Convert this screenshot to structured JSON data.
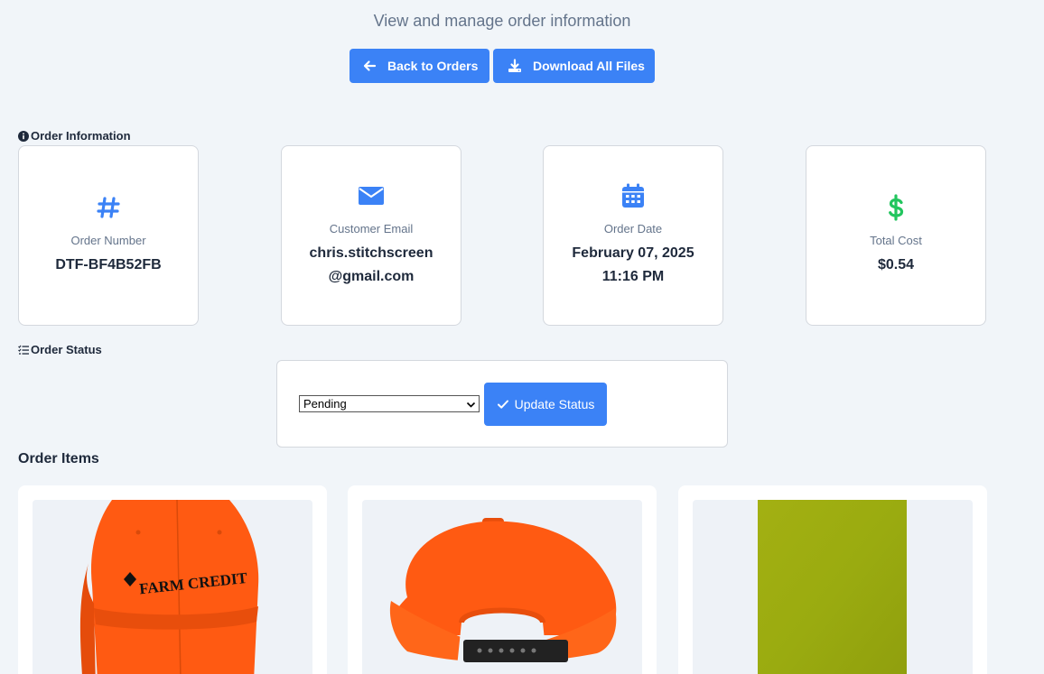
{
  "header": {
    "subtitle": "View and manage order information"
  },
  "actions": {
    "back_label": "Back to Orders",
    "download_label": "Download All Files"
  },
  "order_info": {
    "section_title": "Order Information",
    "order_number": {
      "label": "Order Number",
      "value": "DTF-BF4B52FB",
      "icon": "hashtag-icon"
    },
    "customer_email": {
      "label": "Customer Email",
      "value_line1": "chris.stitchscreen",
      "value_line2": "@gmail.com",
      "icon": "envelope-icon"
    },
    "order_date": {
      "label": "Order Date",
      "date": "February 07, 2025",
      "time": "11:16 PM",
      "icon": "calendar-icon"
    },
    "total_cost": {
      "label": "Total Cost",
      "value": "$0.54",
      "icon": "dollar-icon"
    }
  },
  "order_status": {
    "section_title": "Order Status",
    "selected": "Pending",
    "update_label": "Update Status"
  },
  "order_items": {
    "title": "Order Items",
    "items": [
      {
        "image": "orange cap front",
        "logo_text": "FARM CREDIT"
      },
      {
        "image": "orange cap back"
      },
      {
        "image": "green fabric swatch"
      }
    ]
  },
  "colors": {
    "accent": "#3b82f6",
    "money": "#22c55e",
    "background": "#f1f5f9"
  }
}
